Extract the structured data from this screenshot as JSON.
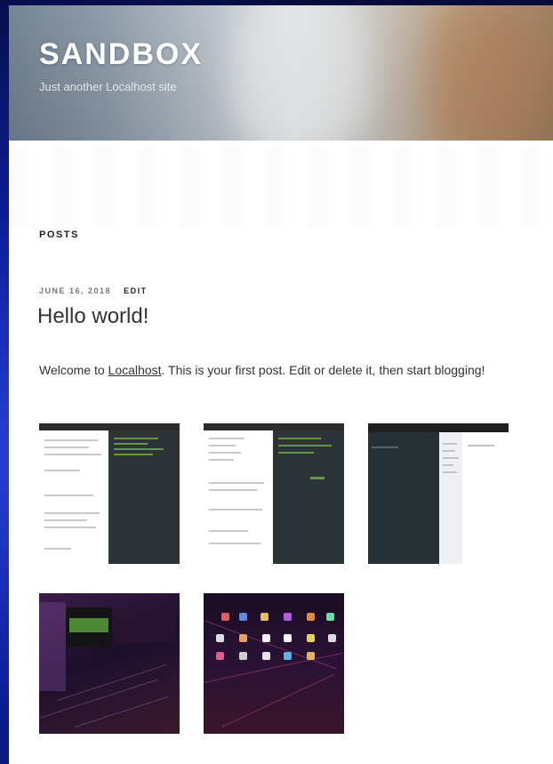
{
  "site": {
    "title": "SANDBOX",
    "tagline": "Just another Localhost site"
  },
  "section": {
    "heading": "POSTS"
  },
  "post": {
    "date": "JUNE 16, 2018",
    "edit_label": "EDIT",
    "title": "Hello world!",
    "body_before_link": "Welcome to ",
    "link_text": "Localhost",
    "body_after_link": ". This is your first post. Edit or delete it, then start blogging!"
  },
  "gallery": {
    "items": [
      {
        "icon": "screenshot-terminal-doc"
      },
      {
        "icon": "screenshot-terminal-doc"
      },
      {
        "icon": "screenshot-file-manager"
      },
      {
        "icon": "screenshot-purple-desktop"
      },
      {
        "icon": "screenshot-icon-desktop"
      }
    ]
  },
  "colors": {
    "outer_background": "#0d1f9a",
    "page_background": "#ffffff",
    "text": "#333333"
  }
}
